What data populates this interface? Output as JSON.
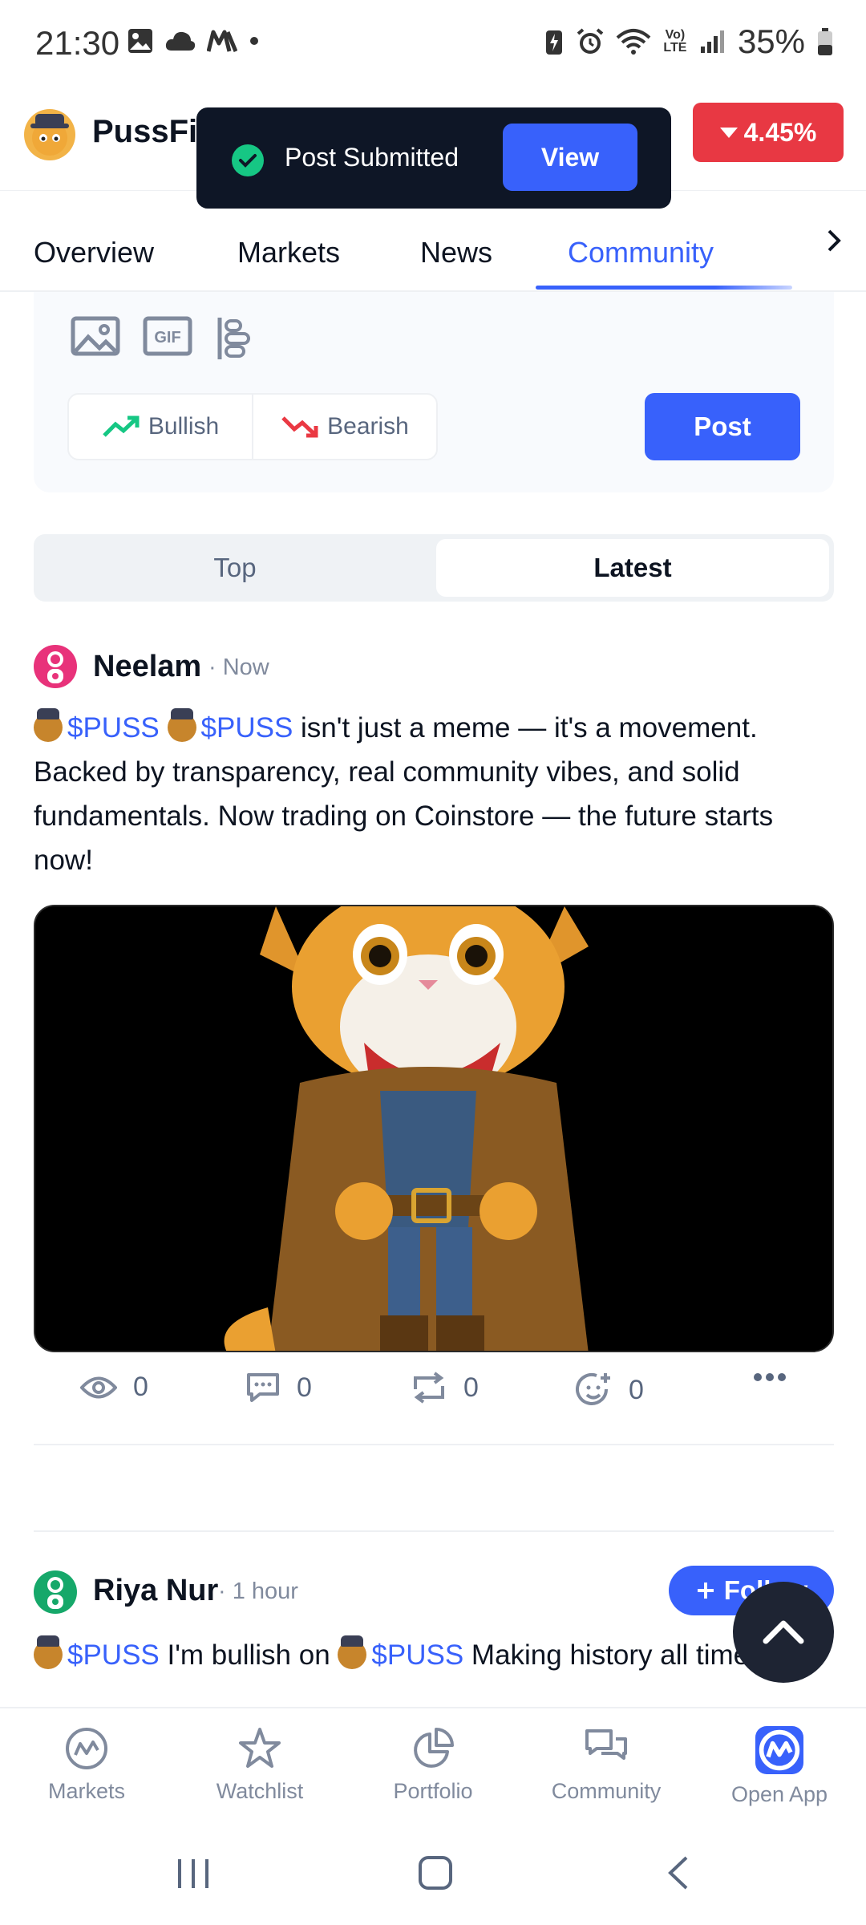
{
  "status_bar": {
    "time": "21:30",
    "battery": "35%",
    "network": "Vo) LTE",
    "left_icons": [
      "image-icon",
      "cloud-icon",
      "m-app-icon",
      "dot-icon"
    ],
    "right_icons": [
      "battery-saver-icon",
      "alarm-icon",
      "wifi-icon",
      "signal-icon",
      "battery-icon"
    ]
  },
  "header": {
    "coin_name": "PussFi",
    "price_change": "4.45%",
    "change_color": "#e83843"
  },
  "toast": {
    "message": "Post Submitted",
    "action": "View"
  },
  "tabs": [
    {
      "label": "Overview"
    },
    {
      "label": "Markets"
    },
    {
      "label": "News"
    },
    {
      "label": "Community",
      "active": true
    }
  ],
  "composer": {
    "tools": [
      "image-icon",
      "gif-icon",
      "poll-icon"
    ],
    "bullish": "Bullish",
    "bearish": "Bearish",
    "post_label": "Post"
  },
  "sort": {
    "options": [
      "Top",
      "Latest"
    ],
    "selected": "Latest"
  },
  "posts": [
    {
      "author": "Neelam",
      "time": "· Now",
      "text_parts": [
        "$PUSS",
        "$PUSS",
        " isn't just a meme — it's a movement. Backed by transparency, real community vibes, and solid fundamentals. Now trading on Coinstore — the future starts now!"
      ],
      "has_image": true,
      "stats": {
        "views": "0",
        "comments": "0",
        "reposts": "0",
        "reactions": "0"
      }
    },
    {
      "author": "Riya Nur",
      "time": "· 1 hour",
      "follow_label": "Follow",
      "text_parts": [
        "$PUSS",
        " I'm bullish on ",
        "$PUSS",
        " Making history all time"
      ]
    }
  ],
  "bottom_nav": [
    {
      "label": "Markets",
      "icon": "markets-icon"
    },
    {
      "label": "Watchlist",
      "icon": "star-icon"
    },
    {
      "label": "Portfolio",
      "icon": "pie-chart-icon"
    },
    {
      "label": "Community",
      "icon": "chat-bubbles-icon"
    },
    {
      "label": "Open App",
      "icon": "coinmarketcap-icon"
    }
  ],
  "colors": {
    "accent": "#3861fb",
    "bullish": "#16c784",
    "bearish": "#ea3943"
  }
}
